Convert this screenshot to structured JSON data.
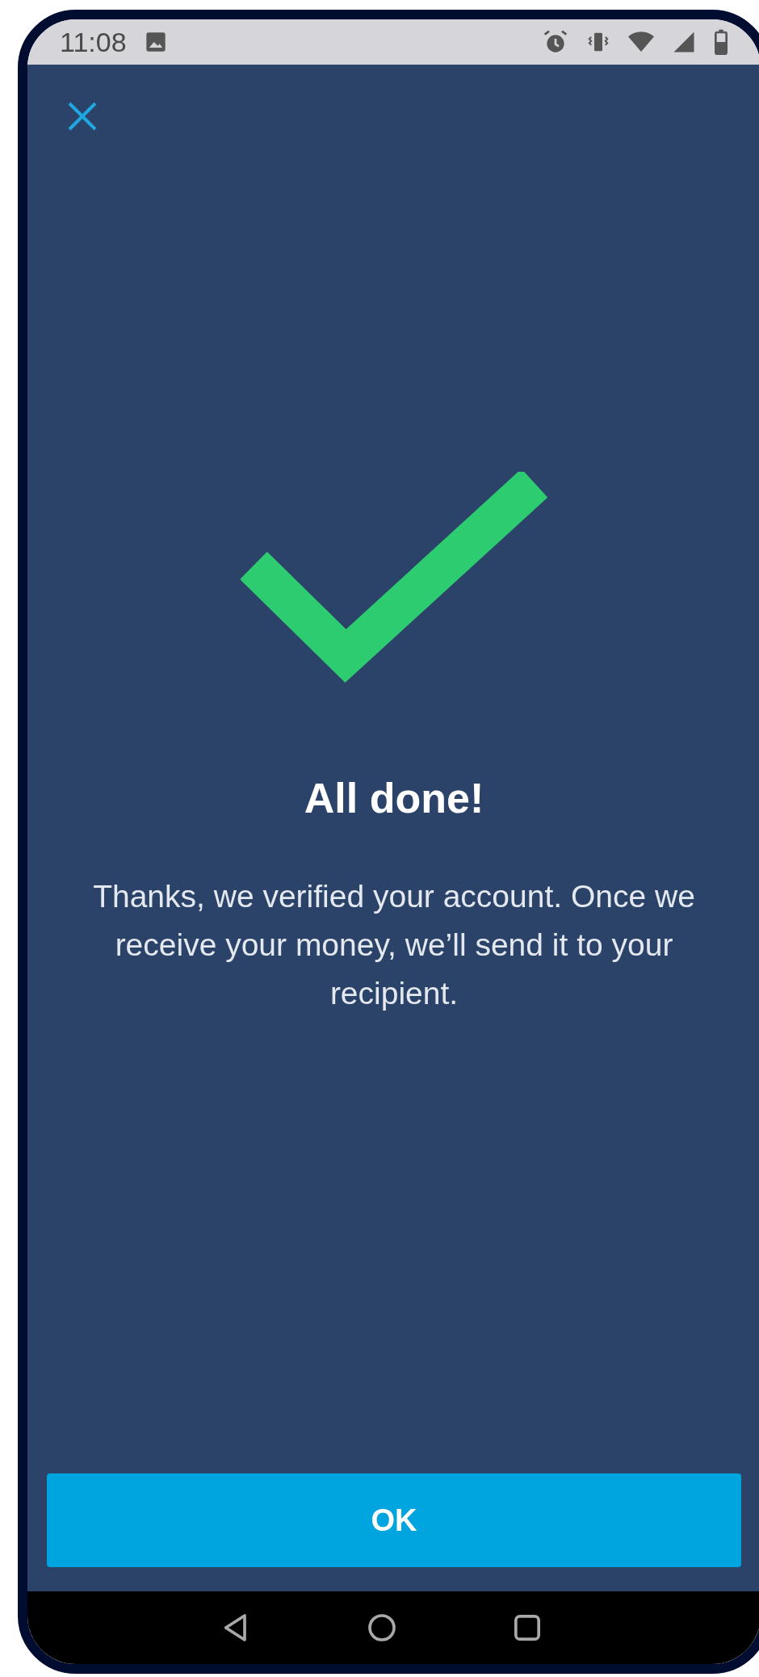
{
  "status_bar": {
    "time": "11:08"
  },
  "title": "All done!",
  "message": "Thanks, we verified your account. Once we receive your money, we’ll send it to your recipient.",
  "button": {
    "label": "OK"
  }
}
